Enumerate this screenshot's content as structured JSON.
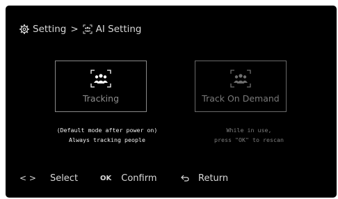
{
  "breadcrumb": {
    "root_icon": "gear-icon",
    "root_label": "Setting",
    "separator": ">",
    "current_icon": "ai-people-icon",
    "current_label": "AI Setting"
  },
  "modes": [
    {
      "title": "Tracking",
      "icon": "people-tracking-icon",
      "selected": true,
      "description_line1": "(Default mode after power on)",
      "description_line2": "Always tracking people"
    },
    {
      "title": "Track On Demand",
      "icon": "people-tracking-icon",
      "selected": false,
      "description_line1": "While in use,",
      "description_line2": "press \"OK\" to rescan"
    }
  ],
  "footer": {
    "select_key": "< >",
    "select_label": "Select",
    "confirm_key": "OK",
    "confirm_label": "Confirm",
    "return_icon": "return-arrow-icon",
    "return_label": "Return"
  },
  "colors": {
    "background": "#000000",
    "text": "#d9d9d9",
    "border_active": "#8a8a8a",
    "muted": "#7a7a7a"
  }
}
